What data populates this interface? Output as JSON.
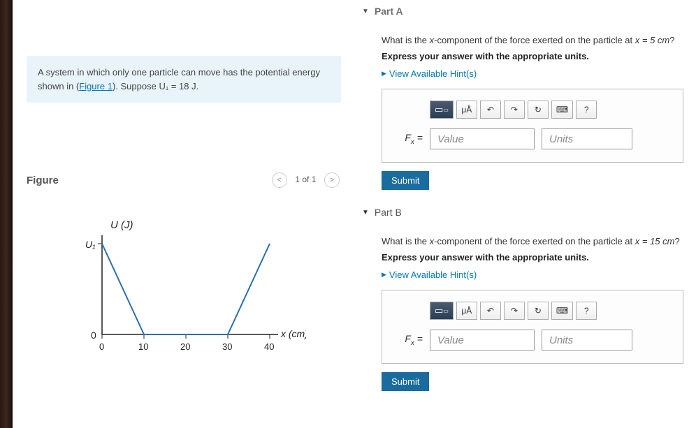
{
  "problem": {
    "text_pre": "A system in which only one particle can move has the potential energy shown in (",
    "link": "Figure 1",
    "text_post": "). Suppose U₁ = 18 J."
  },
  "figure": {
    "title": "Figure",
    "nav_prev": "<",
    "nav_text": "1 of 1",
    "nav_next": ">"
  },
  "chart_data": {
    "type": "line",
    "title": "",
    "xlabel": "x (cm)",
    "ylabel": "U (J)",
    "y_ticks": [
      "U₁",
      "0"
    ],
    "x_ticks": [
      0,
      10,
      20,
      30,
      40
    ],
    "xlim": [
      0,
      42
    ],
    "series": [
      {
        "name": "U",
        "points": [
          [
            0,
            18
          ],
          [
            10,
            0
          ],
          [
            30,
            0
          ],
          [
            40,
            18
          ]
        ]
      }
    ]
  },
  "partA": {
    "header": "Part A",
    "question_pre": "What is the ",
    "question_var": "x",
    "question_mid": "-component of the force exerted on the particle at ",
    "question_eq": "x = 5 cm",
    "question_post": "?",
    "instruction": "Express your answer with the appropriate units.",
    "hints": "View Available Hint(s)",
    "var": "Fₓ =",
    "value_ph": "Value",
    "units_ph": "Units",
    "submit": "Submit",
    "tools": {
      "mu": "μÅ",
      "undo": "↶",
      "redo": "↷",
      "reset": "↻",
      "kbd": "⌨",
      "help": "?"
    }
  },
  "partB": {
    "header": "Part B",
    "question_pre": "What is the ",
    "question_var": "x",
    "question_mid": "-component of the force exerted on the particle at ",
    "question_eq": "x = 15 cm",
    "question_post": "?",
    "instruction": "Express your answer with the appropriate units.",
    "hints": "View Available Hint(s)",
    "var": "Fₓ =",
    "value_ph": "Value",
    "units_ph": "Units",
    "submit": "Submit",
    "tools": {
      "mu": "μÅ",
      "undo": "↶",
      "redo": "↷",
      "reset": "↻",
      "kbd": "⌨",
      "help": "?"
    }
  }
}
